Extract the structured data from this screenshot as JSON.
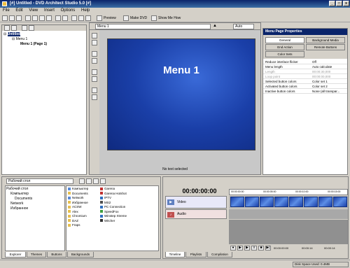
{
  "window": {
    "title": "[#] Untitled - DVD Architect Studio 5.0 [#]"
  },
  "menu": [
    "File",
    "Edit",
    "View",
    "Insert",
    "Options",
    "Help"
  ],
  "toolbar": {
    "preview": "Preview",
    "make_dvd": "Make DVD",
    "show_me_how": "Show Me How"
  },
  "project_tree": {
    "root": "Untitled",
    "menu": "Menu 1",
    "page": "Menu 1 (Page 1)"
  },
  "menu_path": "Menu 1",
  "zoom": "Auto",
  "canvas": {
    "title": "Menu 1",
    "status": "No text selected"
  },
  "properties": {
    "title": "Menu Page Properties",
    "tabs": [
      "General",
      "Background Media",
      "End Action",
      "Remote Buttons",
      "Color Sets"
    ],
    "rows": [
      {
        "key": "Reduce interlace flicker",
        "value": "Off"
      },
      {
        "key": "Menu length",
        "value": "Auto calculate"
      },
      {
        "key": "Length",
        "value": "00:00:30,000"
      },
      {
        "key": "Loop point",
        "value": "00:00:00,000"
      },
      {
        "key": "Selected button colors",
        "value": "Color set 1"
      },
      {
        "key": "Activated button colors",
        "value": "Color set 2"
      },
      {
        "key": "Inactive button colors",
        "value": "None (all transpar..."
      }
    ]
  },
  "explorer": {
    "location": "Рабочий стол",
    "tree": [
      "Рабочий стол",
      "Компьютер",
      "Documents",
      "Network",
      "Избранное"
    ],
    "col1": [
      "Компьютер",
      "Documents",
      "Network",
      "Избранное",
      "ACSW",
      "Alex",
      "Chromium",
      "DAZ",
      "Fraps"
    ],
    "col2": [
      "Garena",
      "Garena Hotshot",
      "IPTV",
      "MS2",
      "PC Connection",
      "SpeedFox",
      "Winstep Xtreme",
      "Witcher"
    ],
    "tabs": [
      "Explorer",
      "Themes",
      "Buttons",
      "Backgrounds"
    ]
  },
  "timeline": {
    "time": "00:00:00:00",
    "ruler": [
      "00:00:00:00",
      "00:00:05:00",
      "00:00:10:00",
      "00:00:15:00"
    ],
    "tracks": [
      "Video",
      "Audio"
    ],
    "clip_count": 8,
    "tabs": [
      "Timeline",
      "Playlists",
      "Compilation"
    ],
    "readouts": [
      "00:00:00:00",
      "00:00:14",
      "00:00:14"
    ],
    "disk": "Disk Space Used: 0.4MB"
  },
  "colors": {
    "title": "#0a246a",
    "canvas_bg": "#1a3fa8",
    "prop_header": "#0a246a",
    "clip": "#2f6fd6",
    "audio_track": "#c05050"
  }
}
